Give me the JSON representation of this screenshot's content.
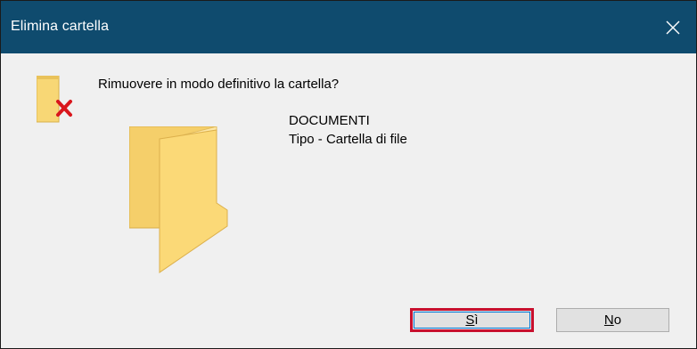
{
  "dialog": {
    "title": "Elimina cartella",
    "close_icon": "close-icon",
    "message": "Rimuovere in modo definitivo la cartella?",
    "folder_name": "DOCUMENTI",
    "folder_type": "Tipo - Cartella di file",
    "icons": {
      "delete_folder": "folder-delete-icon",
      "folder": "folder-icon"
    }
  },
  "buttons": {
    "yes_label_first": "S",
    "yes_label_rest": "ì",
    "no_label_first": "N",
    "no_label_rest": "o"
  },
  "colors": {
    "titlebar": "#0f4b6e",
    "dialog_bg": "#f0f0f0",
    "folder_yellow": "#f8d775",
    "delete_red": "#d9161c",
    "highlight_border": "#c8102e"
  }
}
